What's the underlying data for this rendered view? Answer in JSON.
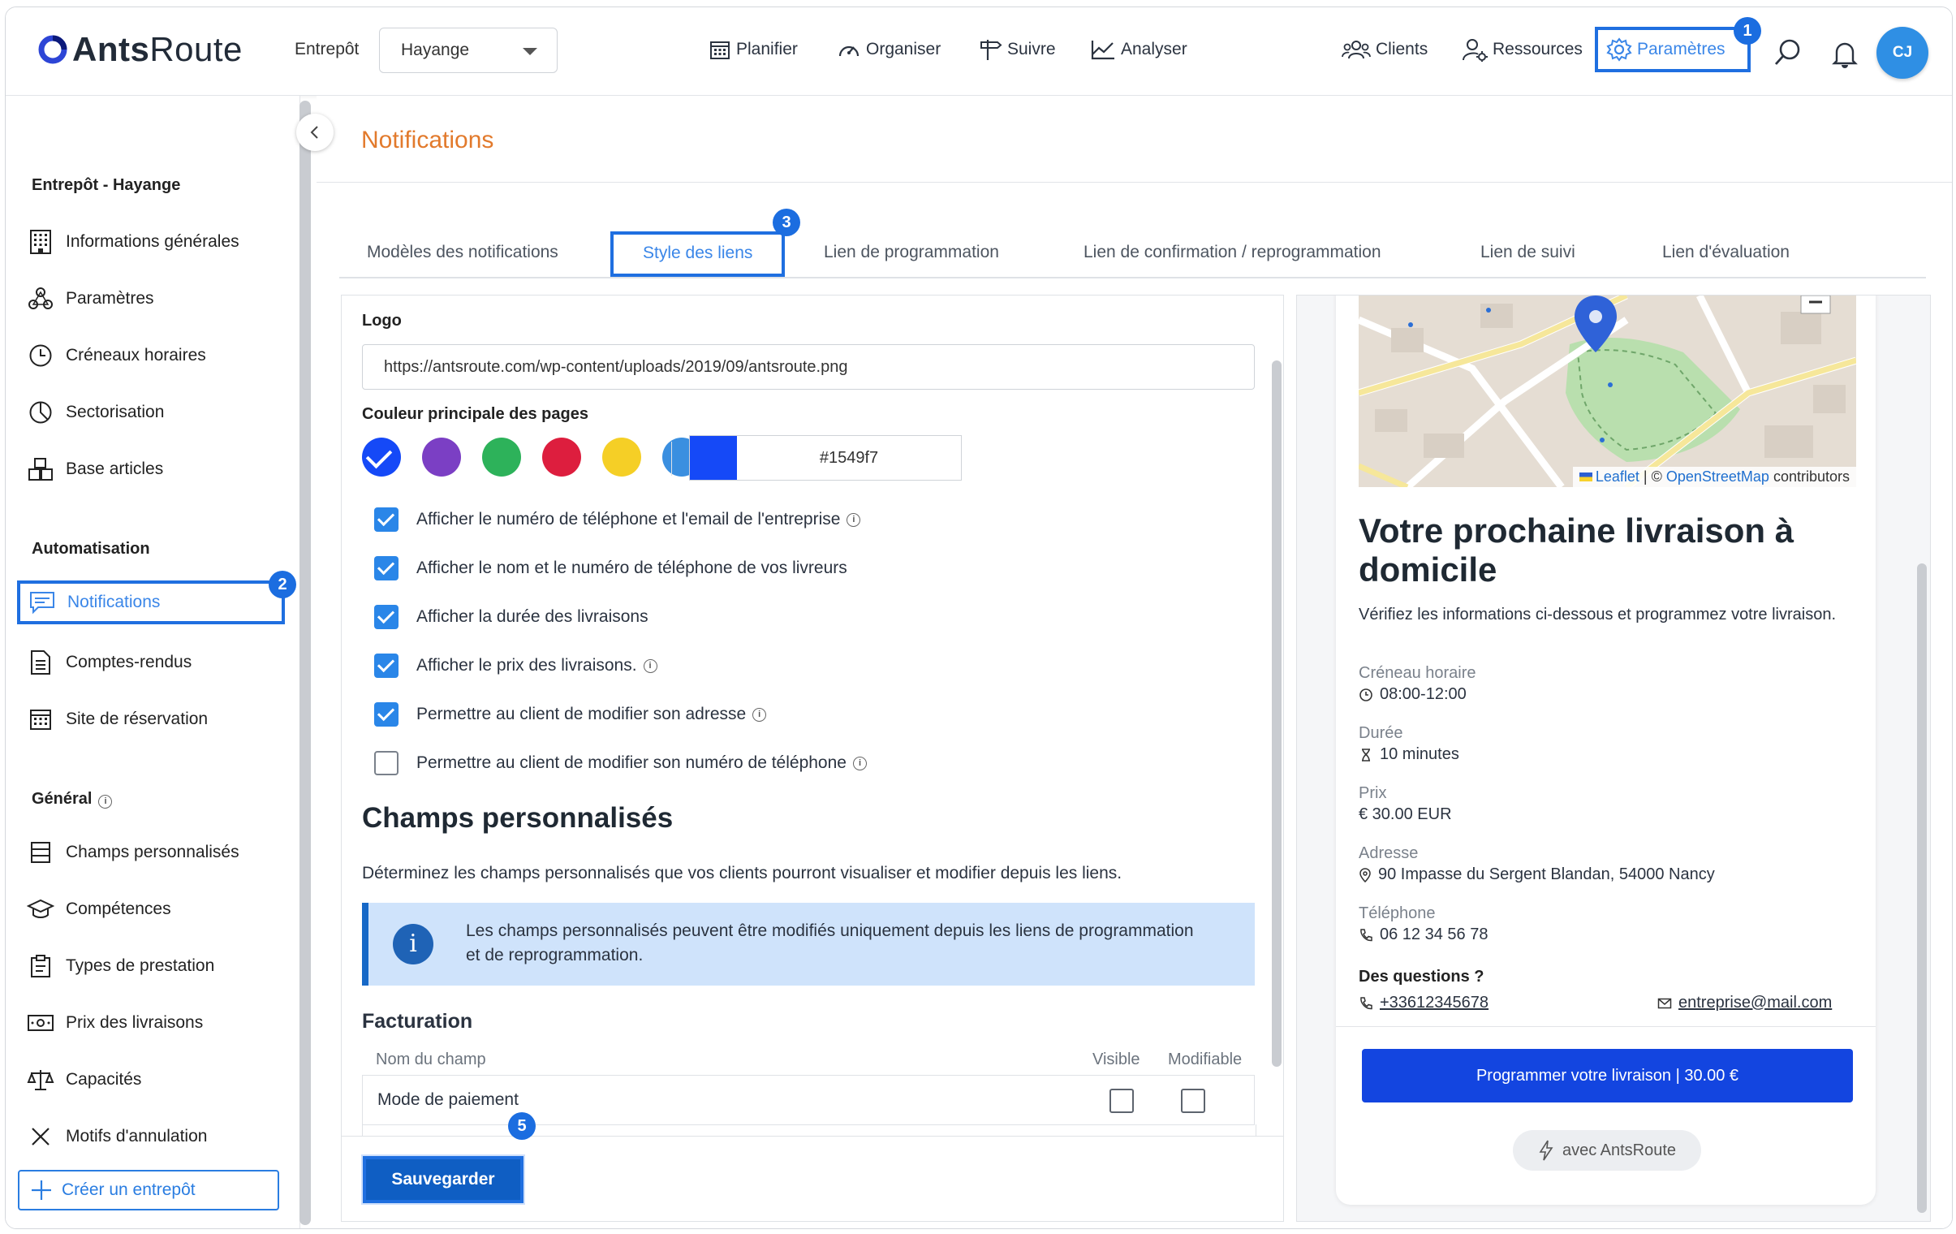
{
  "header": {
    "logo_bold": "Ants",
    "logo_light": "Route",
    "warehouse_label": "Entrepôt",
    "warehouse_value": "Hayange",
    "nav_center": [
      {
        "label": "Planifier",
        "icon": "calendar-icon"
      },
      {
        "label": "Organiser",
        "icon": "gauge-icon"
      },
      {
        "label": "Suivre",
        "icon": "signpost-icon"
      },
      {
        "label": "Analyser",
        "icon": "chart-icon"
      }
    ],
    "nav_right": [
      {
        "label": "Clients",
        "icon": "users-icon"
      },
      {
        "label": "Ressources",
        "icon": "user-gear-icon"
      },
      {
        "label": "Paramètres",
        "icon": "gear-icon"
      }
    ],
    "avatar_initials": "CJ",
    "accent_color": "#1f6fe0"
  },
  "badges": {
    "b1": "1",
    "b2": "2",
    "b3": "3",
    "b5": "5"
  },
  "sidebar": {
    "section_warehouse": "Entrepôt - Hayange",
    "warehouse_items": [
      {
        "label": "Informations générales",
        "icon": "building-icon"
      },
      {
        "label": "Paramètres",
        "icon": "network-icon"
      },
      {
        "label": "Créneaux horaires",
        "icon": "clock-icon"
      },
      {
        "label": "Sectorisation",
        "icon": "pie-icon"
      },
      {
        "label": "Base articles",
        "icon": "boxes-icon"
      }
    ],
    "section_automation": "Automatisation",
    "automation_items": [
      {
        "label": "Notifications",
        "icon": "message-icon"
      },
      {
        "label": "Comptes-rendus",
        "icon": "document-icon"
      },
      {
        "label": "Site de réservation",
        "icon": "calendar-grid-icon"
      }
    ],
    "section_general": "Général",
    "general_items": [
      {
        "label": "Champs personnalisés",
        "icon": "rows-icon"
      },
      {
        "label": "Compétences",
        "icon": "graduation-icon"
      },
      {
        "label": "Types de prestation",
        "icon": "clipboard-icon"
      },
      {
        "label": "Prix des livraisons",
        "icon": "money-icon"
      },
      {
        "label": "Capacités",
        "icon": "scale-icon"
      },
      {
        "label": "Motifs d'annulation",
        "icon": "close-icon"
      }
    ],
    "create_label": "Créer un entrepôt"
  },
  "page": {
    "title": "Notifications",
    "tabs": [
      "Modèles des notifications",
      "Style des liens",
      "Lien de programmation",
      "Lien de confirmation / reprogrammation",
      "Lien de suivi",
      "Lien d'évaluation"
    ],
    "active_tab": "Style des liens"
  },
  "form": {
    "logo_label": "Logo",
    "logo_url": "https://antsroute.com/wp-content/uploads/2019/09/antsroute.png",
    "color_label": "Couleur principale des pages",
    "swatches": [
      "#1549f7",
      "#7b3fc4",
      "#2db25a",
      "#dd1e3e",
      "#f5cf26",
      "#3a8fe0"
    ],
    "selected_color": "#1549f7",
    "options": [
      {
        "label": "Afficher le numéro de téléphone et l'email de l'entreprise",
        "checked": true,
        "info": true
      },
      {
        "label": "Afficher le nom et le numéro de téléphone de vos livreurs",
        "checked": true,
        "info": false
      },
      {
        "label": "Afficher la durée des livraisons",
        "checked": true,
        "info": false
      },
      {
        "label": "Afficher le prix des livraisons.",
        "checked": true,
        "info": true
      },
      {
        "label": "Permettre au client de modifier son adresse",
        "checked": true,
        "info": true
      },
      {
        "label": "Permettre au client de modifier son numéro de téléphone",
        "checked": false,
        "info": true
      }
    ],
    "custom_fields_title": "Champs personnalisés",
    "custom_fields_desc": "Déterminez les champs personnalisés que vos clients pourront visualiser et modifier depuis les liens.",
    "alert_text": "Les champs personnalisés peuvent être modifiés uniquement depuis les liens de programmation et de reprogrammation.",
    "billing_title": "Facturation",
    "col_name": "Nom du champ",
    "col_visible": "Visible",
    "col_editable": "Modifiable",
    "rows": [
      {
        "name": "Mode de paiement",
        "visible": false,
        "editable": false
      }
    ],
    "save_label": "Sauvegarder"
  },
  "preview": {
    "map_attrib_leaflet": "Leaflet",
    "map_attrib_sep": "| ©",
    "map_attrib_osm": "OpenStreetMap",
    "map_attrib_tail": "contributors",
    "title": "Votre prochaine livraison à domicile",
    "subtitle": "Vérifiez les informations ci-dessous et programmez votre livraison.",
    "slot_label": "Créneau horaire",
    "slot_value": "08:00-12:00",
    "duration_label": "Durée",
    "duration_value": "10 minutes",
    "price_label": "Prix",
    "price_value": "€ 30.00 EUR",
    "address_label": "Adresse",
    "address_value": "90 Impasse du Sergent Blandan, 54000 Nancy",
    "phone_label": "Téléphone",
    "phone_value": "06 12 34 56 78",
    "questions_label": "Des questions ?",
    "contact_phone": "+33612345678",
    "contact_email": "entreprise@mail.com",
    "cta_label": "Programmer votre livraison | 30.00 €",
    "powered_label": "avec AntsRoute"
  }
}
